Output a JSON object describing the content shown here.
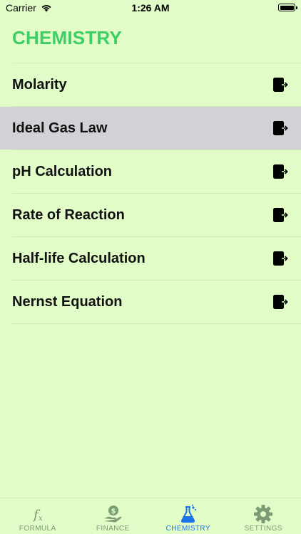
{
  "status_bar": {
    "carrier": "Carrier",
    "time": "1:26 AM"
  },
  "header": {
    "title": "CHEMISTRY"
  },
  "list": {
    "items": [
      {
        "label": "Molarity",
        "selected": false
      },
      {
        "label": "Ideal Gas Law",
        "selected": true
      },
      {
        "label": "pH Calculation",
        "selected": false
      },
      {
        "label": "Rate of Reaction",
        "selected": false
      },
      {
        "label": "Half-life Calculation",
        "selected": false
      },
      {
        "label": "Nernst Equation",
        "selected": false
      }
    ],
    "row_icon": "open-external-icon"
  },
  "tab_bar": {
    "tabs": [
      {
        "label": "FORMULA",
        "icon": "function-icon",
        "active": false
      },
      {
        "label": "FINANCE",
        "icon": "hand-dollar-icon",
        "active": false
      },
      {
        "label": "CHEMISTRY",
        "icon": "flask-icon",
        "active": true
      },
      {
        "label": "SETTINGS",
        "icon": "gear-icon",
        "active": false
      }
    ]
  },
  "colors": {
    "background": "#e2fcc8",
    "title": "#3dcf65",
    "selected_row": "#d1d1d6",
    "active_tab": "#1a73e8",
    "inactive_tab": "#7a9b74"
  }
}
